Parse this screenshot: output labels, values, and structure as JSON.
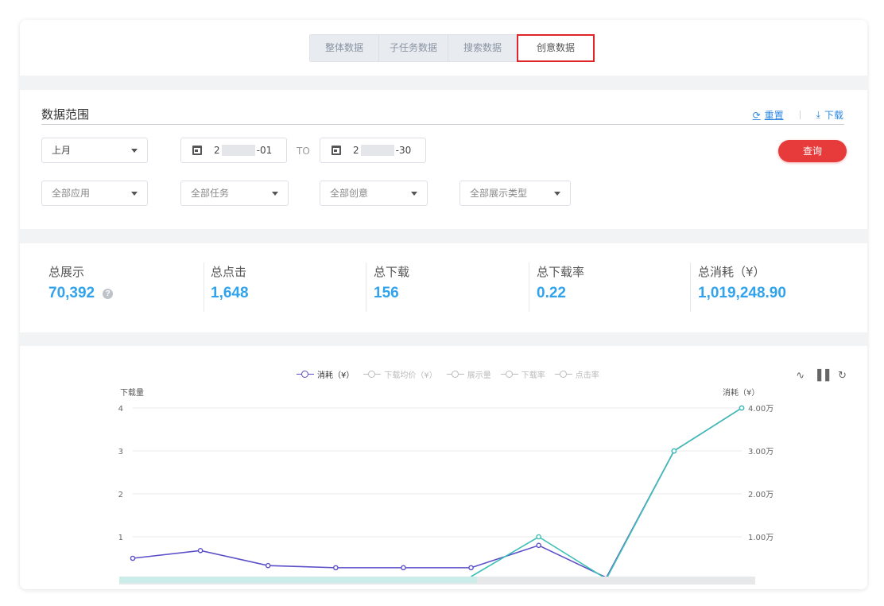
{
  "tabs": [
    {
      "label": "整体数据",
      "active": false
    },
    {
      "label": "子任务数据",
      "active": false
    },
    {
      "label": "搜索数据",
      "active": false
    },
    {
      "label": "创意数据",
      "active": true
    }
  ],
  "filter": {
    "title": "数据范围",
    "reset_label": "重置",
    "download_label": "下载",
    "period": "上月",
    "date_from_prefix": "2",
    "date_from_suffix": "-01",
    "to_label": "TO",
    "date_to_prefix": "2",
    "date_to_suffix": "-30",
    "query_label": "查询",
    "app_select": "全部应用",
    "task_select": "全部任务",
    "creative_select": "全部创意",
    "display_type_select": "全部展示类型"
  },
  "stats": [
    {
      "label": "总展示",
      "value": "70,392"
    },
    {
      "label": "总点击",
      "value": "1,648"
    },
    {
      "label": "总下载",
      "value": "156"
    },
    {
      "label": "总下载率",
      "value": "0.22"
    },
    {
      "label": "总消耗（¥）",
      "value": "1,019,248.90"
    }
  ],
  "help_glyph": "?",
  "legend": [
    {
      "label": "消耗（¥）",
      "active": true
    },
    {
      "label": "下载均价（¥）",
      "active": false
    },
    {
      "label": "展示量",
      "active": false
    },
    {
      "label": "下载率",
      "active": false
    },
    {
      "label": "点击率",
      "active": false
    }
  ],
  "chart_data": {
    "type": "line",
    "y_left_label": "下载量",
    "y_right_label": "消耗（¥）",
    "y_left_ticks": [
      "4",
      "3",
      "2",
      "1"
    ],
    "y_right_ticks": [
      "4.00万",
      "3.00万",
      "2.00万",
      "1.00万"
    ],
    "y_left_range": [
      0,
      4
    ],
    "y_right_range": [
      0,
      40000
    ],
    "series": [
      {
        "name": "下载量",
        "axis": "left",
        "color": "#5b4fc7",
        "values": [
          0.5,
          0.68,
          0.33,
          0.28,
          0.28,
          0.28,
          0.8,
          0.05,
          3.0,
          4.0
        ]
      },
      {
        "name": "消耗（¥）",
        "axis": "right",
        "color": "#3dbfb5",
        "values": [
          0,
          0,
          0,
          0,
          0,
          0,
          10000,
          200,
          30000,
          40000
        ]
      }
    ],
    "grid": true
  }
}
